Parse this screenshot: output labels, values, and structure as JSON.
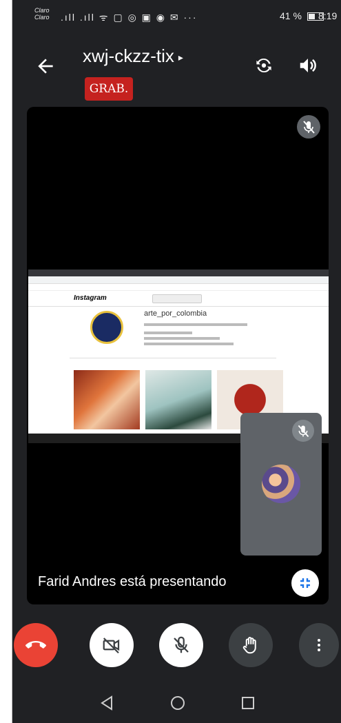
{
  "status_bar": {
    "carrier_line1": "Claro",
    "carrier_line2": "Claro",
    "icons": ".ıll .ıll ᯤ ▢ ◎ ▣ ◉ ✉ ···",
    "battery": "41 %",
    "time": "8:19"
  },
  "header": {
    "meeting_code": "xwj-ckzz-tix",
    "caret": "▸",
    "recording_badge": "GRAB."
  },
  "stage": {
    "shared_page": {
      "site_logo": "Instagram",
      "account_name": "arte_por_colombia"
    }
  },
  "presenter_text": "Farid Andres está presentando",
  "colors": {
    "background": "#202124",
    "end_call": "#ea4335",
    "recording": "#c5221f"
  },
  "icons": {
    "back": "arrow-left-icon",
    "camera_switch": "camera-switch-icon",
    "speaker": "speaker-icon",
    "mic_off": "mic-off-icon",
    "video_off": "video-off-icon",
    "hand": "raise-hand-icon",
    "more": "more-vert-icon",
    "minimize": "minimize-icon",
    "end_call": "call-end-icon"
  }
}
